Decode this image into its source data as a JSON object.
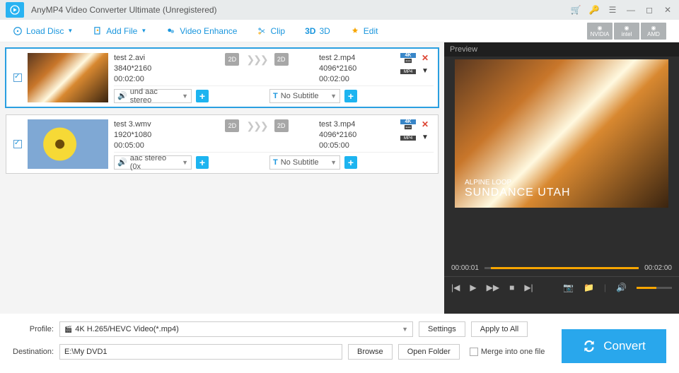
{
  "title": "AnyMP4 Video Converter Ultimate (Unregistered)",
  "toolbar": {
    "load_disc": "Load Disc",
    "add_file": "Add File",
    "video_enhance": "Video Enhance",
    "clip": "Clip",
    "three_d": "3D",
    "edit": "Edit"
  },
  "gpu": [
    "NVIDIA",
    "intel",
    "AMD"
  ],
  "items": [
    {
      "src_name": "test 2.avi",
      "src_res": "3840*2160",
      "src_dur": "00:02:00",
      "src_fmt": "2D",
      "dst_fmt": "2D",
      "dst_name": "test 2.mp4",
      "dst_res": "4096*2160",
      "dst_dur": "00:02:00",
      "quality": "4K",
      "container": "MP4",
      "audio": "und aac stereo",
      "subtitle": "No Subtitle",
      "checked": true,
      "selected": true
    },
    {
      "src_name": "test 3.wmv",
      "src_res": "1920*1080",
      "src_dur": "00:05:00",
      "src_fmt": "2D",
      "dst_fmt": "2D",
      "dst_name": "test 3.mp4",
      "dst_res": "4096*2160",
      "dst_dur": "00:05:00",
      "quality": "4K",
      "container": "MP4",
      "audio": "aac stereo (0x",
      "subtitle": "No Subtitle",
      "checked": true,
      "selected": false
    }
  ],
  "preview": {
    "label": "Preview",
    "line1": "ALPINE LOOP",
    "line2": "SUNDANCE UTAH",
    "cur": "00:00:01",
    "total": "00:02:00"
  },
  "bottom": {
    "profile_label": "Profile:",
    "profile_value": "4K H.265/HEVC Video(*.mp4)",
    "settings": "Settings",
    "apply_all": "Apply to All",
    "dest_label": "Destination:",
    "dest_value": "E:\\My DVD1",
    "browse": "Browse",
    "open_folder": "Open Folder",
    "merge": "Merge into one file",
    "convert": "Convert"
  }
}
